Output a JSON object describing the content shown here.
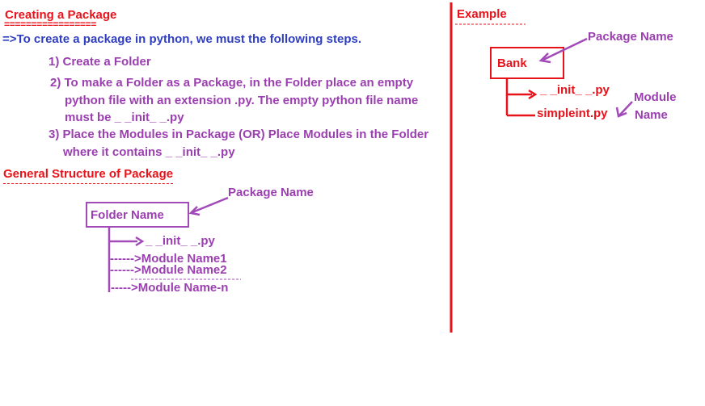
{
  "left": {
    "title": "Creating a Package",
    "title_rule": "=================",
    "intro": "=>To create a package in python, we must the following steps.",
    "steps": [
      "1) Create a Folder",
      "2) To make a Folder as a Package, in the Folder place an empty",
      "python  file with an extension .py. The empty python file name",
      "must be  _ _init_ _.py",
      "3) Place the Modules in Package (OR) Place Modules in the Folder",
      "where it contains  _ _init_ _.py"
    ],
    "structure_title": "General Structure of Package",
    "folder_label": "Folder Name",
    "package_name_label": "Package Name",
    "init_file": "_ _init_ _.py",
    "modules": [
      "------>Module Name1",
      "------>Module Name2",
      "----->Module Name-n"
    ]
  },
  "right": {
    "title": "Example",
    "package_name_label": "Package Name",
    "bank_label": "Bank",
    "init_file": "_ _init_ _.py",
    "module_file": "simpleint.py",
    "module_label_1": "Module",
    "module_label_2": "Name"
  },
  "colors": {
    "red": "#e8121a",
    "blue": "#2f3fc0",
    "purple": "#9b3fb0"
  }
}
